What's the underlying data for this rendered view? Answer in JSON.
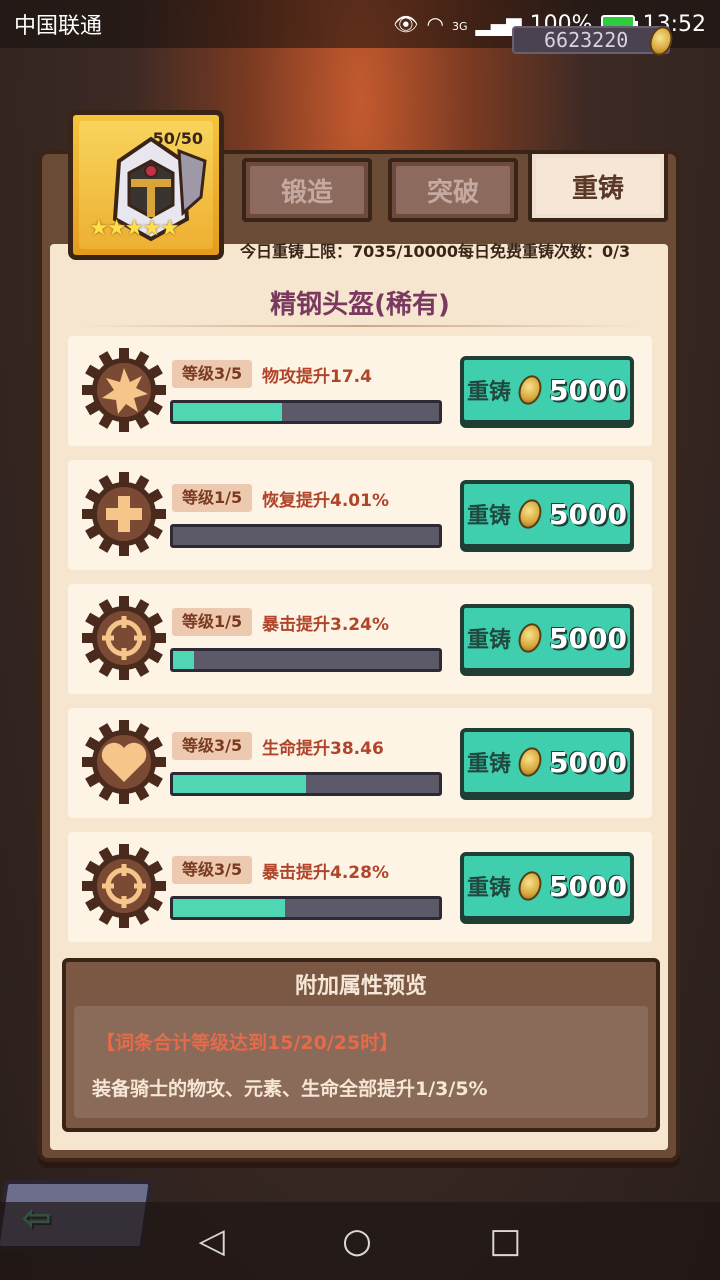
{
  "status_bar": {
    "carrier": "中国联通",
    "network": "3G",
    "battery": "100%",
    "time": "13:52"
  },
  "gold": "6623220",
  "equipment": {
    "level_count": "50/50",
    "stars": 5,
    "name": "精钢头盔(稀有)"
  },
  "tabs": [
    {
      "label": "锻造",
      "active": false
    },
    {
      "label": "突破",
      "active": false
    },
    {
      "label": "重铸",
      "active": true
    }
  ],
  "limits": {
    "text": "今日重铸上限：7035/10000每日免费重铸次数：0/3"
  },
  "attributes": [
    {
      "icon": "explosion-icon",
      "level": "等级3/5",
      "stat": "物攻提升17.4",
      "progress": 0.41,
      "button": "重铸",
      "cost": "5000"
    },
    {
      "icon": "plus-icon",
      "level": "等级1/5",
      "stat": "恢复提升4.01%",
      "progress": 0.0,
      "button": "重铸",
      "cost": "5000"
    },
    {
      "icon": "crosshair-icon",
      "level": "等级1/5",
      "stat": "暴击提升3.24%",
      "progress": 0.08,
      "button": "重铸",
      "cost": "5000"
    },
    {
      "icon": "heart-icon",
      "level": "等级3/5",
      "stat": "生命提升38.46",
      "progress": 0.5,
      "button": "重铸",
      "cost": "5000"
    },
    {
      "icon": "crosshair-icon",
      "level": "等级3/5",
      "stat": "暴击提升4.28%",
      "progress": 0.42,
      "button": "重铸",
      "cost": "5000"
    }
  ],
  "preview": {
    "title": "附加属性预览",
    "line1": "【词条合计等级达到15/20/25时】",
    "line2": "装备骑士的物攻、元素、生命全部提升1/3/5%"
  },
  "colors": {
    "accent": "#3fcfae",
    "bar_fill": "#4fd6b2",
    "title": "#7a3a60",
    "stat_text": "#b0452a"
  }
}
